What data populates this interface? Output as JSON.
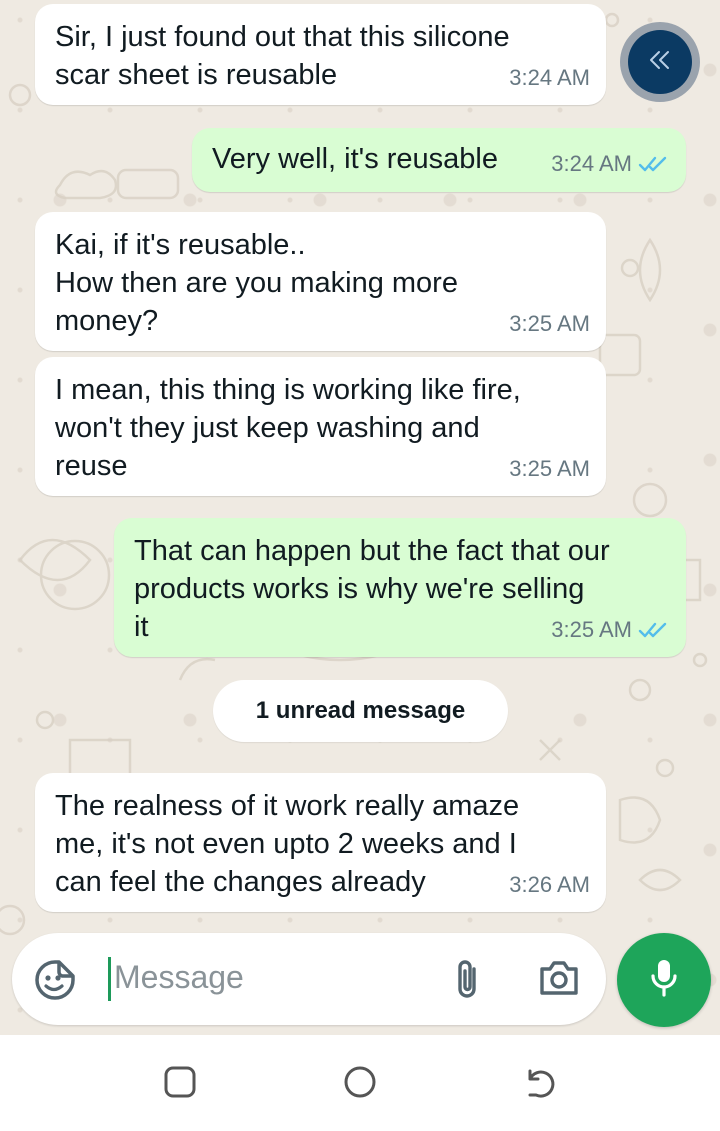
{
  "messages": [
    {
      "direction": "in",
      "text": "Sir, I just found out that this silicone\nscar sheet is reusable",
      "time": "3:24 AM"
    },
    {
      "direction": "out",
      "text": "Very well, it's reusable",
      "time": "3:24 AM",
      "status": "read"
    },
    {
      "direction": "in",
      "text": "Kai, if it's reusable..\nHow then are you making more\nmoney?",
      "time": "3:25 AM"
    },
    {
      "direction": "in",
      "text": "I mean, this thing is working like fire,\nwon't they just keep washing and\nreuse",
      "time": "3:25 AM"
    },
    {
      "direction": "out",
      "text": "That can happen but the fact that our\nproducts works is why we're selling\nit",
      "time": "3:25 AM",
      "status": "read"
    },
    {
      "direction": "in",
      "text": "The realness of it work really amaze\nme, it's not even upto 2 weeks and I\ncan feel the changes already",
      "time": "3:26 AM"
    }
  ],
  "unread_divider": "1 unread message",
  "composer": {
    "placeholder": "Message",
    "emoji_icon": "sticker-smiley-icon",
    "attach_icon": "paperclip-icon",
    "camera_icon": "camera-icon",
    "mic_icon": "microphone-icon"
  },
  "scroll_button_icon": "double-chevron-left-icon",
  "nav": {
    "recents_icon": "recents-square-icon",
    "home_icon": "home-circle-icon",
    "back_icon": "back-arrow-icon"
  },
  "colors": {
    "chat_background": "#efeae2",
    "incoming_bubble": "#ffffff",
    "outgoing_bubble": "#d9fdd3",
    "read_tick": "#53bdeb",
    "mic_button": "#1ea55a",
    "scroll_button": "#0b3a63"
  }
}
